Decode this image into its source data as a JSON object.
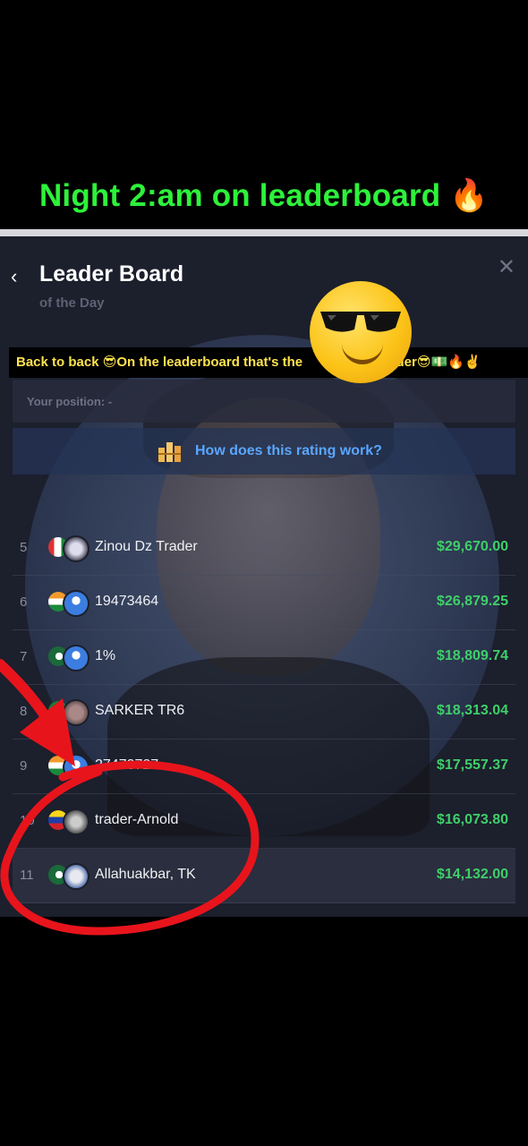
{
  "caption": "Night 2:am on leaderboard 🔥",
  "header": {
    "back_icon": "‹",
    "title": "Leader Board",
    "subtitle": "of the Day",
    "close_icon": "✕"
  },
  "banner": {
    "text_a": "Back to back 😎On the leaderboard that's the ",
    "text_b": "eal trader😎💵🔥✌️"
  },
  "position": {
    "label": "Your position:  -"
  },
  "rating_link": "How does this rating work?",
  "leaderboard": [
    {
      "rank": "5",
      "name": "Zinou Dz Trader",
      "amount": "$29,670.00"
    },
    {
      "rank": "6",
      "name": "19473464",
      "amount": "$26,879.25"
    },
    {
      "rank": "7",
      "name": "1%",
      "amount": "$18,809.74"
    },
    {
      "rank": "8",
      "name": "SARKER TR6",
      "amount": "$18,313.04"
    },
    {
      "rank": "9",
      "name": "27473727",
      "amount": "$17,557.37"
    },
    {
      "rank": "10",
      "name": "trader-Arnold",
      "amount": "$16,073.80"
    },
    {
      "rank": "11",
      "name": "Allahuakbar, TK",
      "amount": "$14,132.00"
    }
  ],
  "colors": {
    "caption": "#2df23a",
    "amount": "#3fcf6a",
    "link": "#5aa7ff",
    "annotation": "#e8141c"
  }
}
